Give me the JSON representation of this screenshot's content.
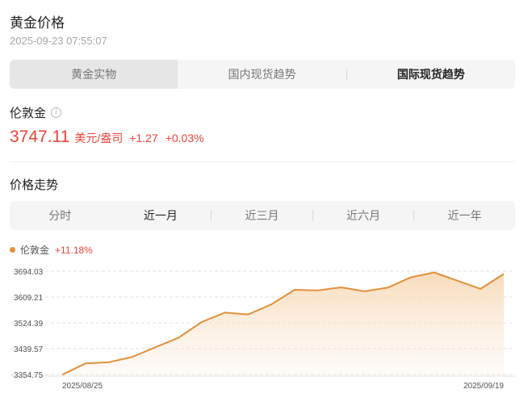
{
  "header": {
    "title": "黄金价格",
    "timestamp": "2025-09-23 07:55:07"
  },
  "category_tabs": [
    {
      "label": "黄金实物",
      "active": true
    },
    {
      "label": "国内现货趋势",
      "active": false
    },
    {
      "label": "国际现货趋势",
      "active": false
    }
  ],
  "quote": {
    "name": "伦敦金",
    "price": "3747.11",
    "unit": "美元/盎司",
    "change": "+1.27",
    "change_pct": "+0.03%"
  },
  "trend": {
    "title": "价格走势",
    "ranges": [
      {
        "label": "分时",
        "active": false
      },
      {
        "label": "近一月",
        "active": true
      },
      {
        "label": "近三月",
        "active": false
      },
      {
        "label": "近六月",
        "active": false
      },
      {
        "label": "近一年",
        "active": false
      }
    ]
  },
  "colors": {
    "accent_line": "#e1913c",
    "up_red": "#e8453c"
  },
  "chart_data": {
    "type": "area",
    "legend": {
      "name": "伦敦金",
      "change_pct": "+11.18%"
    },
    "y_ticks": [
      "3694.03",
      "3609.21",
      "3524.39",
      "3439.57",
      "3354.75"
    ],
    "ylim": [
      3354.75,
      3694.03
    ],
    "x_ticks": [
      "2025/08/25",
      "2025/09/19"
    ],
    "x": [
      "2025/08/25",
      "2025/08/26",
      "2025/08/27",
      "2025/08/28",
      "2025/08/29",
      "2025/09/01",
      "2025/09/02",
      "2025/09/03",
      "2025/09/04",
      "2025/09/05",
      "2025/09/08",
      "2025/09/09",
      "2025/09/10",
      "2025/09/11",
      "2025/09/12",
      "2025/09/15",
      "2025/09/16",
      "2025/09/17",
      "2025/09/18",
      "2025/09/19"
    ],
    "series": [
      {
        "name": "伦敦金",
        "values": [
          3354.0,
          3391.0,
          3395.0,
          3412.0,
          3444.0,
          3475.0,
          3527.0,
          3558.0,
          3552.0,
          3585.0,
          3633.0,
          3631.0,
          3641.0,
          3628.0,
          3640.0,
          3674.0,
          3690.0,
          3663.0,
          3636.0,
          3685.0
        ]
      }
    ],
    "grid": true
  }
}
